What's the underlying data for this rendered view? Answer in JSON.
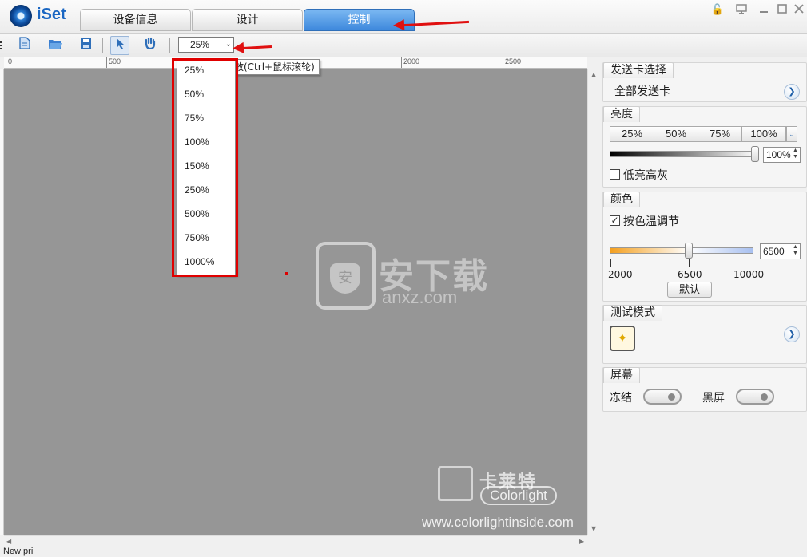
{
  "app": {
    "name": "iSet"
  },
  "tabs": [
    {
      "label": "设备信息",
      "active": false
    },
    {
      "label": "设计",
      "active": false
    },
    {
      "label": "控制",
      "active": true
    }
  ],
  "window_buttons": [
    "lock-icon",
    "monitor-icon",
    "minimize-icon",
    "maximize-icon",
    "close-icon"
  ],
  "toolbar": {
    "zoom_value": "25%",
    "zoom_tooltip": "放大/缩放(Ctrl+鼠标滚轮)",
    "tooltip_visible_text": "放(Ctrl+鼠标滚轮)"
  },
  "zoom_options": [
    "25%",
    "50%",
    "75%",
    "100%",
    "150%",
    "250%",
    "500%",
    "750%",
    "1000%"
  ],
  "ruler": {
    "labels": [
      "0",
      "500",
      "2000",
      "2500"
    ]
  },
  "right_panel": {
    "sender_card": {
      "title": "发送卡选择",
      "value": "全部发送卡"
    },
    "brightness": {
      "title": "亮度",
      "presets": [
        "25%",
        "50%",
        "75%",
        "100%"
      ],
      "value": "100%",
      "level": 1.0,
      "low_bright_gray_label": "低亮高灰",
      "low_bright_gray_checked": false
    },
    "color": {
      "title": "颜色",
      "temp_adjust_label": "按色温调节",
      "temp_adjust_checked": true,
      "temp_value": "6500",
      "scale_min": "2000",
      "scale_mid": "6500",
      "scale_max": "10000",
      "default_button": "默认"
    },
    "test_mode": {
      "title": "测试模式"
    },
    "screen": {
      "title": "屏幕",
      "freeze_label": "冻结",
      "black_label": "黑屏"
    }
  },
  "watermarks": {
    "anxz_cn": "安下载",
    "anxz_url": "anxz.com",
    "colorlight_cn": "卡莱特",
    "colorlight_en": "Colorlight",
    "colorlight_url": "www.colorlightinside.com"
  },
  "status": {
    "text": "New pri"
  },
  "colors": {
    "accent": "#3d88dc",
    "canvas": "#969696",
    "highlight": "#e00000"
  }
}
